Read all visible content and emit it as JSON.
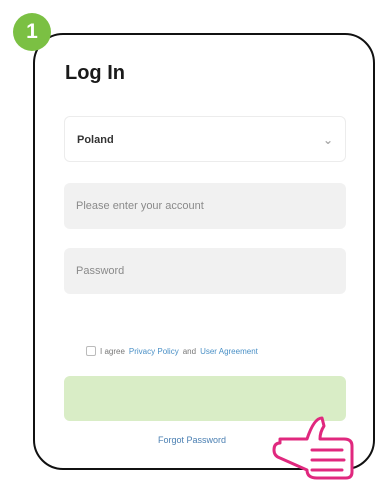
{
  "step": {
    "number": "1",
    "color": "#7bc043"
  },
  "login": {
    "title": "Log In",
    "country": "Poland",
    "account_placeholder": "Please enter your account",
    "password_placeholder": "Password",
    "agree_prefix": "I agree",
    "privacy_policy": "Privacy Policy",
    "and": "and",
    "user_agreement": "User Agreement",
    "forgot_password": "Forgot Password"
  },
  "colors": {
    "hand": "#e0287e",
    "button_bg": "#d9edc6"
  }
}
